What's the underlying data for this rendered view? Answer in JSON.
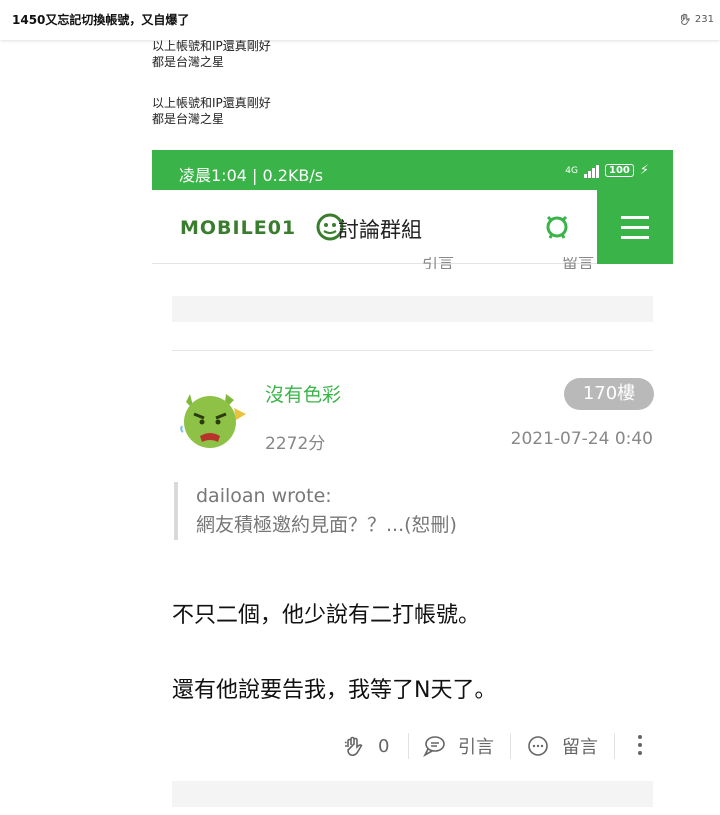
{
  "topbar": {
    "title": "1450又忘記切換帳號，又自爆了",
    "like_count": "231",
    "like_icon": "clap-icon"
  },
  "quoted_lines": [
    "以上帳號和IP還真剛好",
    "都是台灣之星",
    "以上帳號和IP還真剛好",
    "都是台灣之星"
  ],
  "phone": {
    "status": {
      "time_speed": "凌晨1:04 | 0.2KB/s",
      "network": "4G",
      "battery": "100",
      "accent": "#3ab449"
    },
    "appbar": {
      "logo_text": "MOBILE01",
      "section_title": "討論群組",
      "search_icon": "search-icon",
      "menu_icon": "hamburger-menu-icon"
    },
    "prev_actions": [
      "引言",
      "留言"
    ],
    "post": {
      "author": "沒有色彩",
      "floor": "170樓",
      "score": "2272分",
      "date": "2021-07-24 0:40",
      "quote_author": "dailoan wrote:",
      "quote_text": "網友積極邀約見面？？...(恕刪)",
      "paragraphs": [
        "不只二個，他少說有二打帳號。",
        "還有他說要告我，我等了N天了。"
      ],
      "actions": {
        "clap_count": "0",
        "quote_label": "引言",
        "comment_label": "留言"
      }
    }
  }
}
